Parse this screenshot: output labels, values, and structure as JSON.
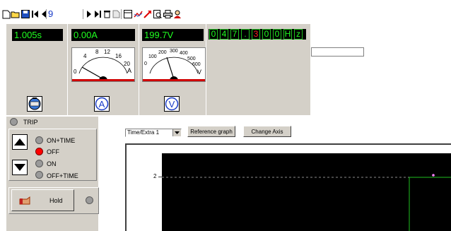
{
  "toolbar": {
    "value": "9"
  },
  "readouts": {
    "time": "1.005s",
    "current": "0.00A",
    "voltage": "199.7V",
    "frequency_digits": [
      "0",
      "4",
      "7",
      ".",
      "3",
      "0",
      "0",
      "H",
      "z"
    ]
  },
  "ammeter": {
    "scale": [
      "0",
      "4",
      "8",
      "12",
      "16",
      "20"
    ],
    "unit": "A",
    "reading": 0.0
  },
  "voltmeter": {
    "scale": [
      "0",
      "100",
      "200",
      "300",
      "400",
      "500",
      "600"
    ],
    "unit": "V",
    "reading": 199.7
  },
  "meter_icons": {
    "ammeter_letter": "A",
    "voltmeter_letter": "V"
  },
  "trip": {
    "label": "TRIP"
  },
  "modes": [
    {
      "label": "ON+TIME",
      "active": false
    },
    {
      "label": "OFF",
      "active": true
    },
    {
      "label": "ON",
      "active": false
    },
    {
      "label": "OFF+TIME",
      "active": false
    }
  ],
  "hold": {
    "label": "Hold"
  },
  "graph_controls": {
    "axis_select": "Time/Extra 1",
    "reference_button": "Reference graph",
    "change_axis_button": "Change Axis"
  },
  "graph": {
    "y_tick": "2"
  },
  "colors": {
    "panel": "#d4d0c8",
    "lcd_bg": "#000000",
    "lcd_text": "#20ff20",
    "needle_base_red": "#d00000",
    "led_active": "#ff0000",
    "trace": "#20c020",
    "marker": "#ff80ff"
  }
}
